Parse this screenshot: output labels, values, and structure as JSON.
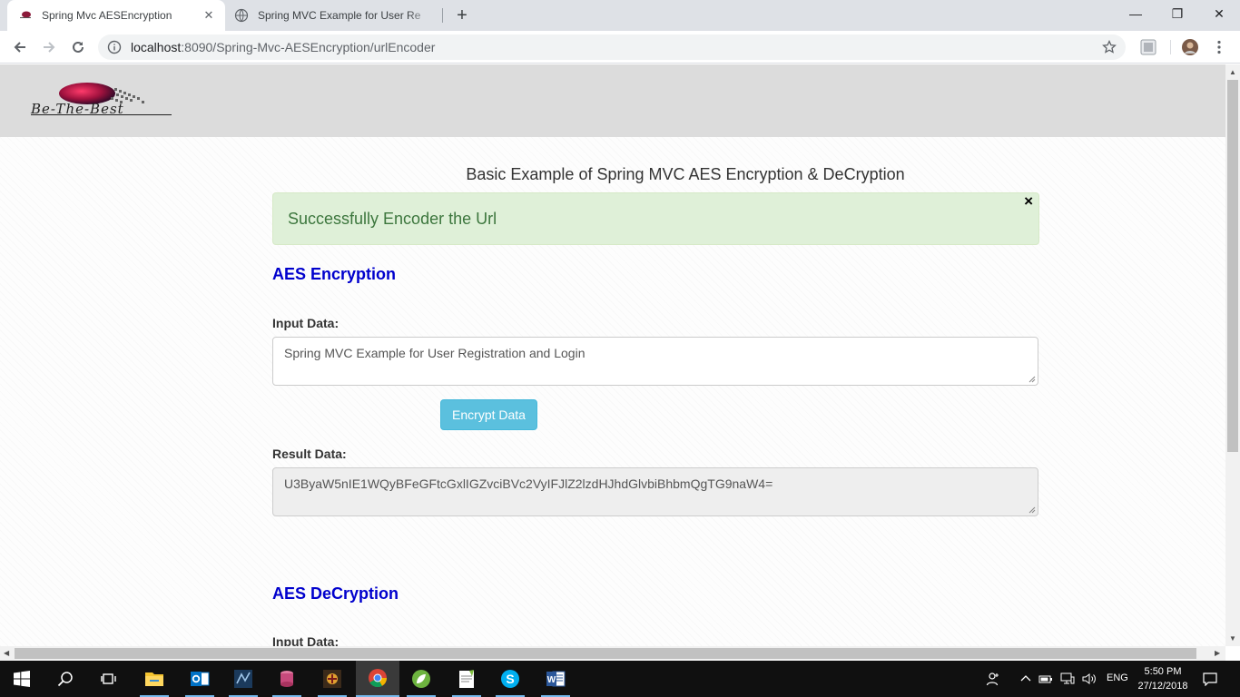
{
  "browser": {
    "tabs": [
      {
        "title": "Spring Mvc AESEncryption",
        "active": true
      },
      {
        "title": "Spring MVC Example for User Re",
        "active": false
      }
    ],
    "address": {
      "host": "localhost",
      "path": ":8090/Spring-Mvc-AESEncryption/urlEncoder"
    },
    "window_controls": {
      "minimize": "—",
      "restore": "❐",
      "close": "✕"
    }
  },
  "page": {
    "logo_text": "Be-The-Best",
    "heading": "Basic Example of Spring MVC AES Encryption & DeCryption",
    "alert": {
      "message": "Successfully Encoder the Url",
      "close": "×"
    },
    "encryption": {
      "title": "AES Encryption",
      "input_label": "Input Data:",
      "input_value": "Spring MVC Example for User Registration and Login",
      "button_label": "Encrypt Data",
      "result_label": "Result Data:",
      "result_value": "U3ByaW5nIE1WQyBFeGFtcGxlIGZvciBVc2VyIFJlZ2lzdHJhdGlvbiBhbmQgTG9naW4="
    },
    "decryption": {
      "title": "AES DeCryption",
      "input_label": "Input Data:"
    }
  },
  "taskbar": {
    "language": "ENG",
    "time": "5:50 PM",
    "date": "27/12/2018",
    "icons": [
      "windows-start",
      "search",
      "task-view",
      "file-explorer",
      "outlook",
      "dev-tool",
      "database-tool",
      "game",
      "chrome",
      "spring-tool-suite",
      "notepad-plus-plus",
      "skype",
      "word"
    ]
  },
  "colors": {
    "alert_bg": "#dff0d8",
    "alert_text": "#3c763d",
    "section_title": "#0000cd",
    "button_info": "#5bc0de"
  }
}
